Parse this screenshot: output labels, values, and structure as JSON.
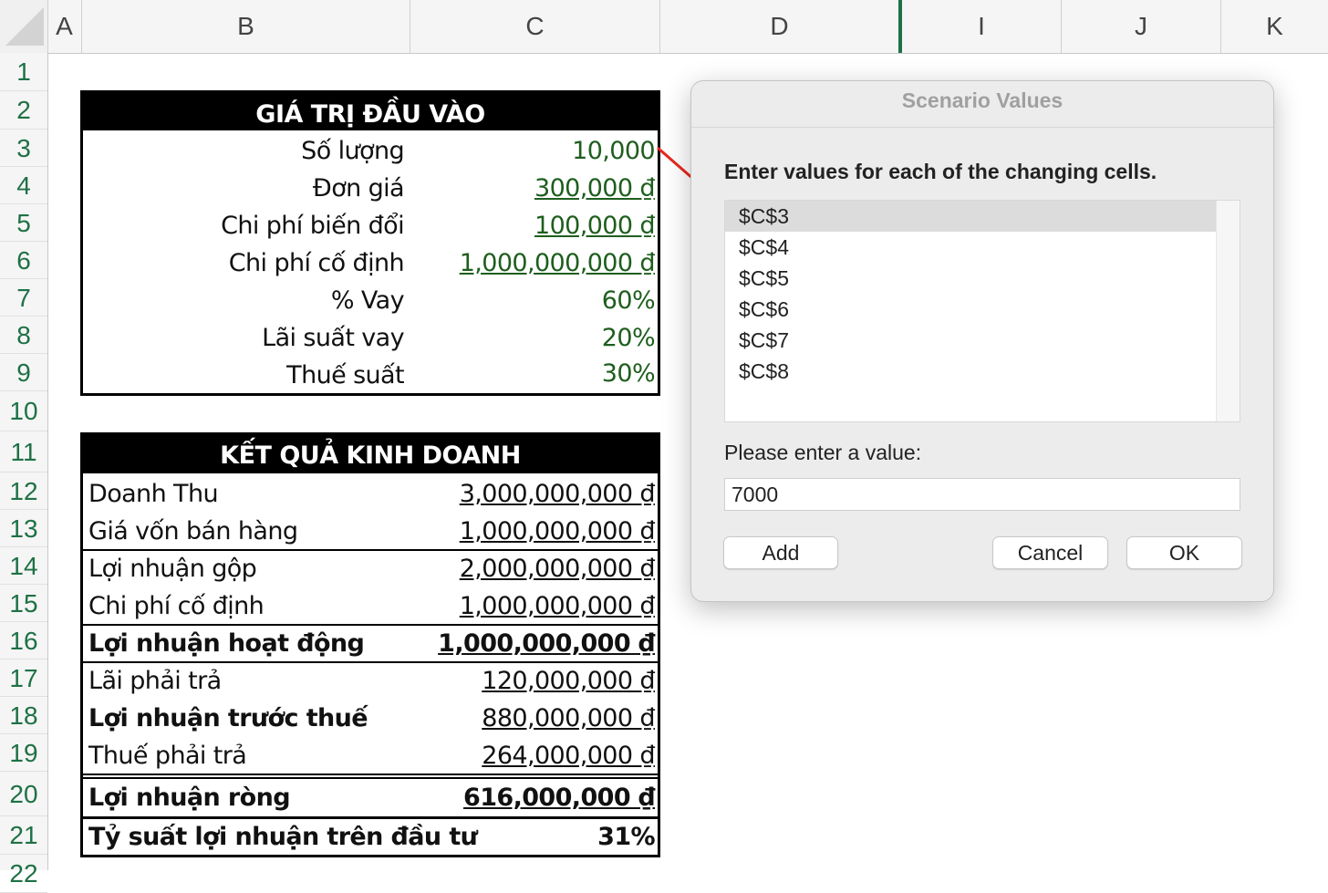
{
  "columns": [
    "A",
    "B",
    "C",
    "D",
    "I",
    "J",
    "K"
  ],
  "rows": [
    "1",
    "2",
    "3",
    "4",
    "5",
    "6",
    "7",
    "8",
    "9",
    "10",
    "11",
    "12",
    "13",
    "14",
    "15",
    "16",
    "17",
    "18",
    "19",
    "20",
    "21",
    "22"
  ],
  "inputs_table": {
    "title": "GIÁ TRỊ ĐẦU VÀO",
    "rows": [
      {
        "label": "Số lượng",
        "value": "10,000"
      },
      {
        "label": "Đơn giá",
        "value": "300,000 ₫"
      },
      {
        "label": "Chi phí biến đổi",
        "value": "100,000 ₫"
      },
      {
        "label": "Chi phí cố định",
        "value": "1,000,000,000 ₫"
      },
      {
        "label": "% Vay",
        "value": "60%"
      },
      {
        "label": "Lãi suất vay",
        "value": "20%"
      },
      {
        "label": "Thuế suất",
        "value": "30%"
      }
    ]
  },
  "results_table": {
    "title": "KẾT QUẢ KINH DOANH",
    "rows": [
      {
        "label": "Doanh Thu",
        "value": "3,000,000,000 ₫"
      },
      {
        "label": "Giá vốn bán hàng",
        "value": "1,000,000,000 ₫"
      },
      {
        "label": "Lợi nhuận gộp",
        "value": "2,000,000,000 ₫"
      },
      {
        "label": "Chi phí cố định",
        "value": "1,000,000,000 ₫"
      },
      {
        "label": "Lợi nhuận hoạt động",
        "value": "1,000,000,000 ₫"
      },
      {
        "label": "Lãi phải trả",
        "value": "120,000,000 ₫"
      },
      {
        "label": "Lợi nhuận trước thuế",
        "value": "880,000,000 ₫"
      },
      {
        "label": "Thuế phải trả",
        "value": "264,000,000 ₫"
      },
      {
        "label": "Lợi nhuận ròng",
        "value": "616,000,000 ₫"
      },
      {
        "label": "Tỷ suất lợi nhuận trên đầu tư",
        "value": "31%"
      }
    ]
  },
  "dialog": {
    "title": "Scenario Values",
    "prompt": "Enter values for each of the changing cells.",
    "cells": [
      "$C$3",
      "$C$4",
      "$C$5",
      "$C$6",
      "$C$7",
      "$C$8"
    ],
    "value_label": "Please enter a value:",
    "value": "7000",
    "add_label": "Add",
    "cancel_label": "Cancel",
    "ok_label": "OK"
  },
  "colors": {
    "row_header_text": "#1e7145",
    "input_value_text": "#1e5e1e",
    "arrow": "#e8281e",
    "frozen_pane_line": "#1e7145"
  },
  "icons": [
    "select-all-corner-icon",
    "red-arrow-annotation-icon"
  ]
}
